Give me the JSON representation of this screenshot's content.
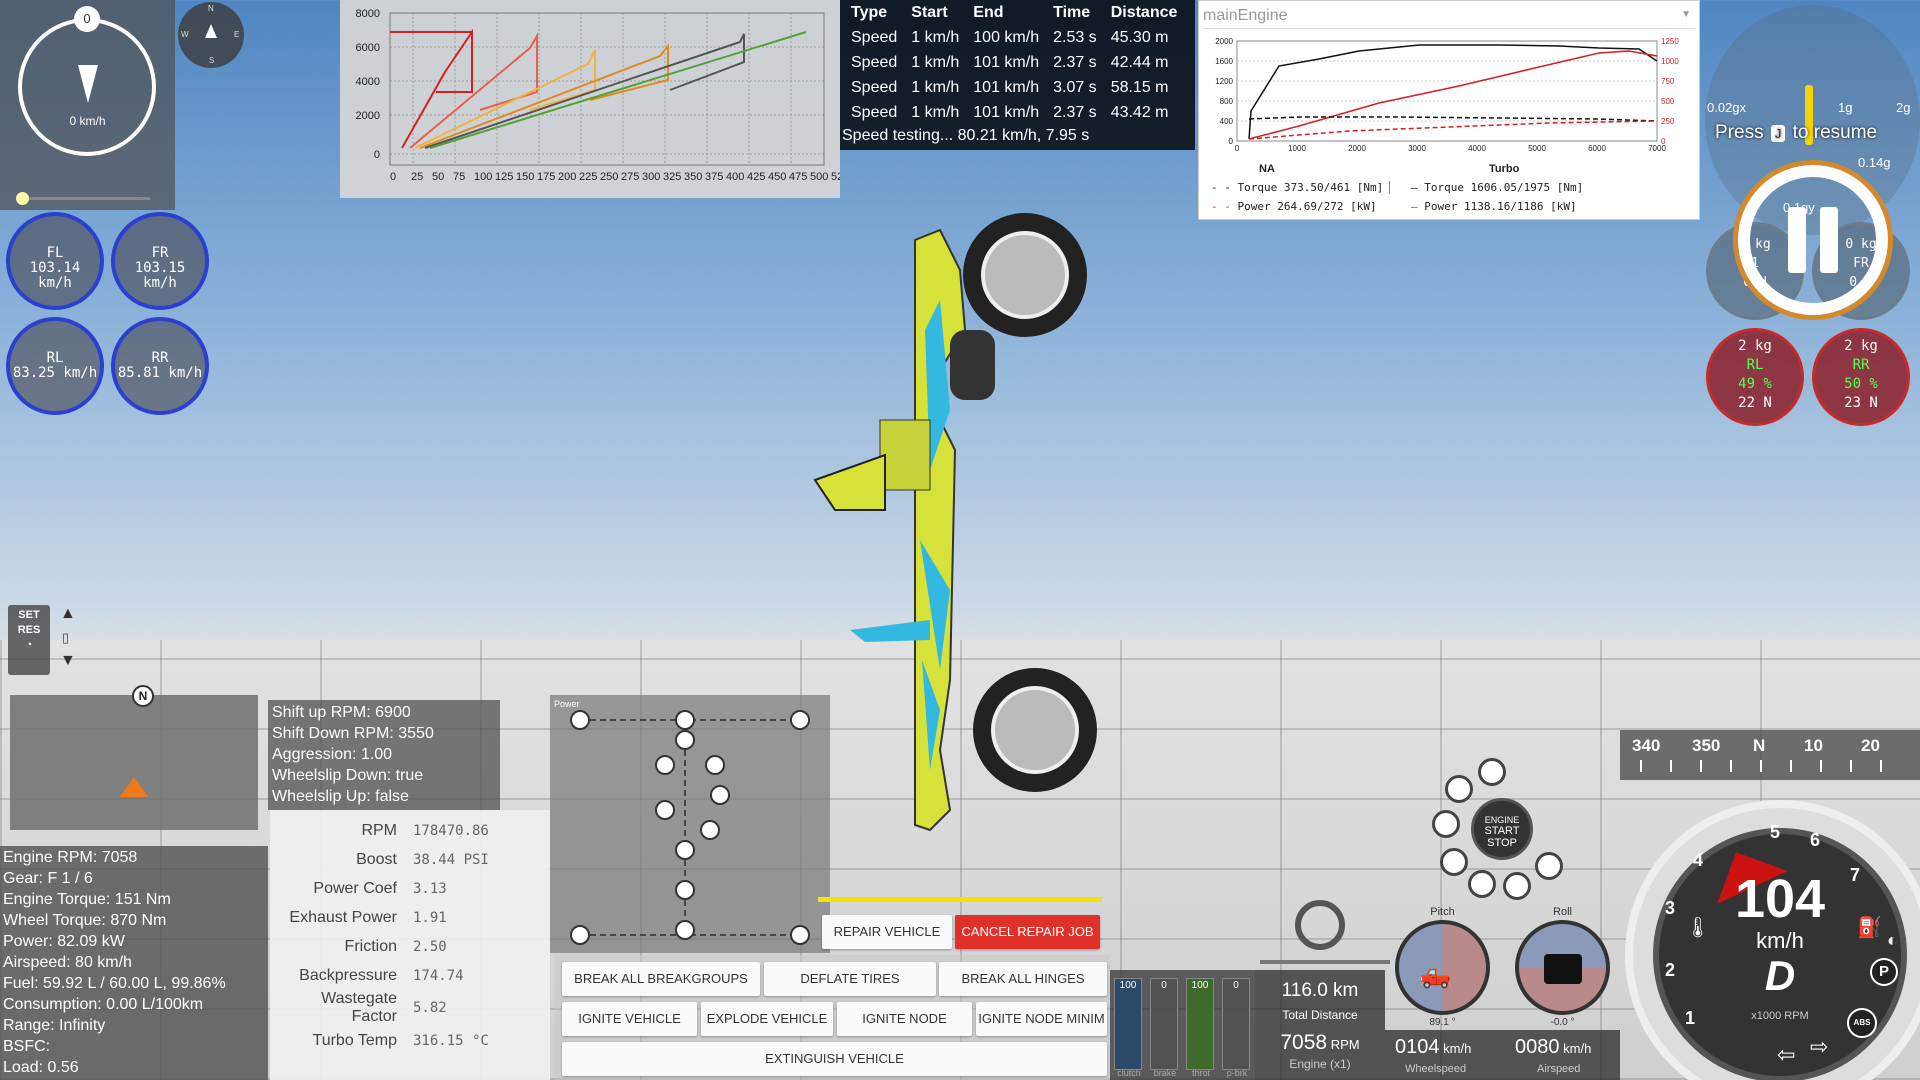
{
  "compass": {
    "knob": "0",
    "speed": "0 km/h",
    "mini_n": "N",
    "mini_w": "W",
    "mini_e": "E",
    "mini_s": "S"
  },
  "wheels_left": [
    {
      "name": "FL",
      "speed": "103.14 km/h"
    },
    {
      "name": "FR",
      "speed": "103.15 km/h"
    },
    {
      "name": "RL",
      "speed": "83.25 km/h"
    },
    {
      "name": "RR",
      "speed": "85.81 km/h"
    }
  ],
  "rpm_chart": {
    "y_ticks": [
      "8000",
      "6000",
      "4000",
      "2000",
      "0"
    ],
    "x_ticks": [
      "0",
      "25",
      "50",
      "75",
      "100",
      "125",
      "150",
      "175",
      "200",
      "225",
      "250",
      "275",
      "300",
      "325",
      "350",
      "375",
      "400",
      "425",
      "450",
      "475",
      "500",
      "525"
    ]
  },
  "speed_table": {
    "headers": [
      "Type",
      "Start",
      "End",
      "Time",
      "Distance"
    ],
    "rows": [
      [
        "Speed",
        "1 km/h",
        "100 km/h",
        "2.53 s",
        "45.30 m"
      ],
      [
        "Speed",
        "1 km/h",
        "101 km/h",
        "2.37 s",
        "42.44 m"
      ],
      [
        "Speed",
        "1 km/h",
        "101 km/h",
        "3.07 s",
        "58.15 m"
      ],
      [
        "Speed",
        "1 km/h",
        "101 km/h",
        "2.37 s",
        "43.42 m"
      ]
    ],
    "status": "Speed testing... 80.21 km/h, 7.95 s"
  },
  "engine_graph": {
    "title": "mainEngine",
    "y_left": [
      "2000",
      "1600",
      "1200",
      "800",
      "400",
      "0"
    ],
    "y_right": [
      "1250",
      "1000",
      "750",
      "500",
      "250",
      "0"
    ],
    "x_ticks": [
      "0",
      "1000",
      "2000",
      "3000",
      "4000",
      "5000",
      "6000",
      "7000"
    ],
    "na_label": "NA",
    "turbo_label": "Turbo",
    "na_torque": "Torque 373.50/461 [Nm]",
    "na_power": "Power  264.69/272 [kW]",
    "turbo_torque": "Torque 1606.05/1975 [Nm]",
    "turbo_power": "Power  1138.16/1186 [kW]"
  },
  "pause": {
    "press": "Press",
    "key": "J",
    "resume": "to resume"
  },
  "gforce": {
    "a": "0.02gx",
    "b": "1g",
    "c": "2g",
    "d": "0.14g",
    "e": "0.1gy"
  },
  "wheels_right_top": [
    {
      "name": "FL",
      "kg": "0 kg",
      "n": "0 N",
      "pct": "1"
    },
    {
      "name": "FR",
      "kg": "0 kg",
      "n": "0 N",
      "pct": "1"
    }
  ],
  "wheels_right_bottom": [
    {
      "name": "RL",
      "kg": "2 kg",
      "pct": "49 %",
      "n": "22 N"
    },
    {
      "name": "RR",
      "kg": "2 kg",
      "pct": "50 %",
      "n": "23 N"
    }
  ],
  "cruise": {
    "set": "SET",
    "res": "RES"
  },
  "minimap": {
    "n": "N"
  },
  "shift": [
    "Shift up RPM: 6900",
    "Shift Down RPM: 3550",
    "Aggression: 1.00",
    "Wheelslip Down: true",
    "Wheelslip Up: false"
  ],
  "stats": [
    "Engine RPM: 7058",
    "Gear: F 1 / 6",
    "Engine Torque: 151 Nm",
    "Wheel Torque: 870 Nm",
    "Power: 82.09 kW",
    "Airspeed: 80 km/h",
    "Fuel: 59.92 L / 60.00 L, 99.86%",
    "Consumption: 0.00 L/100km",
    "Range: Infinity",
    "BSFC:",
    "Load: 0.56"
  ],
  "turbo": [
    {
      "label": "RPM",
      "value": "178470.86"
    },
    {
      "label": "Boost",
      "value": "38.44 PSI"
    },
    {
      "label": "Power Coef",
      "value": "3.13"
    },
    {
      "label": "Exhaust Power",
      "value": "1.91"
    },
    {
      "label": "Friction",
      "value": "2.50"
    },
    {
      "label": "Backpressure",
      "value": "174.74"
    },
    {
      "label": "Wastegate Factor",
      "value": "5.82"
    },
    {
      "label": "Turbo Temp",
      "value": "316.15 °C"
    }
  ],
  "powertrain": {
    "label": "Power"
  },
  "buttons": {
    "repair": "REPAIR VEHICLE",
    "cancel": "CANCEL REPAIR JOB",
    "break_groups": "BREAK ALL BREAKGROUPS",
    "deflate": "DEFLATE TIRES",
    "break_hinges": "BREAK ALL HINGES",
    "ignite": "IGNITE VEHICLE",
    "explode": "EXPLODE VEHICLE",
    "ignite_node": "IGNITE NODE",
    "ignite_node_min": "IGNITE NODE MINIM",
    "extinguish": "EXTINGUISH VEHICLE"
  },
  "pedals": [
    {
      "value": "100",
      "label": "clutch"
    },
    {
      "value": "0",
      "label": "brake"
    },
    {
      "value": "100",
      "label": "throt"
    },
    {
      "value": "0",
      "label": "p-brk"
    }
  ],
  "distance": {
    "value": "116.0 km",
    "label": "Total Distance",
    "rpm": "7058",
    "rpm_unit": "RPM",
    "rpm_label": "Engine (x1)"
  },
  "pitch_roll": {
    "pitch": "Pitch",
    "roll": "Roll",
    "pitch_val": "89.1 °",
    "roll_val": "-0.0 °"
  },
  "wheelspeed": {
    "wheel": "0104",
    "wheel_unit": "km/h",
    "wheel_label": "Wheelspeed",
    "air": "0080",
    "air_unit": "km/h",
    "air_label": "Airspeed"
  },
  "heading": {
    "ticks": [
      "340",
      "350",
      "N",
      "10",
      "20"
    ]
  },
  "speedo": {
    "speed": "104",
    "unit": "km/h",
    "gear": "D",
    "rpm_unit": "x1000 RPM",
    "ticks": [
      "1",
      "2",
      "3",
      "4",
      "5",
      "6",
      "7"
    ],
    "abs": "ABS",
    "park": "P"
  },
  "engine_start": {
    "line1": "ENGINE",
    "line2": "START",
    "line3": "STOP"
  },
  "colors": {
    "accent_red": "#e0302a",
    "wheel_blue": "#2b3fd0",
    "car_yellow": "#d6e23a",
    "car_cyan": "#33b9e0"
  }
}
